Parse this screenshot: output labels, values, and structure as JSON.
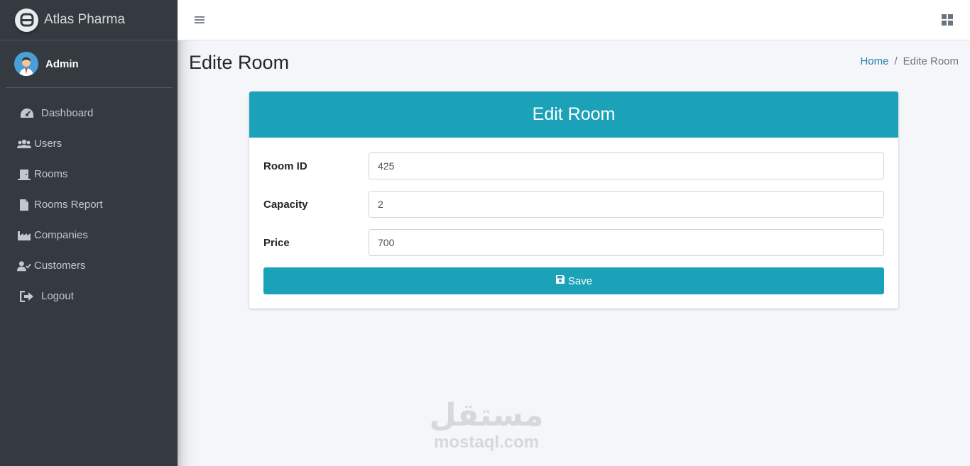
{
  "brand": {
    "name": "Atlas Pharma",
    "logo_icon": "atlas-logo-icon"
  },
  "user": {
    "name": "Admin",
    "avatar_icon": "user-avatar"
  },
  "sidebar": {
    "items": [
      {
        "label": "Dashboard",
        "icon": "tachometer-icon"
      },
      {
        "label": "Users",
        "icon": "users-icon"
      },
      {
        "label": "Rooms",
        "icon": "door-icon"
      },
      {
        "label": "Rooms Report",
        "icon": "file-icon"
      },
      {
        "label": "Companies",
        "icon": "industry-icon"
      },
      {
        "label": "Customers",
        "icon": "user-check-icon"
      },
      {
        "label": "Logout",
        "icon": "sign-out-icon"
      }
    ]
  },
  "header": {
    "menu_icon": "bars-icon",
    "apps_icon": "th-large-icon"
  },
  "page": {
    "title": "Edite Room",
    "breadcrumb": {
      "home": "Home",
      "separator": "/",
      "current": "Edite Room"
    }
  },
  "form": {
    "header": "Edit Room",
    "fields": [
      {
        "label": "Room ID",
        "value": "425"
      },
      {
        "label": "Capacity",
        "value": "2"
      },
      {
        "label": "Price",
        "value": "700"
      }
    ],
    "save_label": "Save",
    "save_icon": "floppy-disk-icon"
  },
  "watermark": {
    "arabic": "مستقل",
    "latin": "mostaql.com"
  },
  "colors": {
    "sidebar": "#343a40",
    "accent": "#1ca2b8",
    "link": "#2a7fa8",
    "background": "#f4f6f9"
  }
}
